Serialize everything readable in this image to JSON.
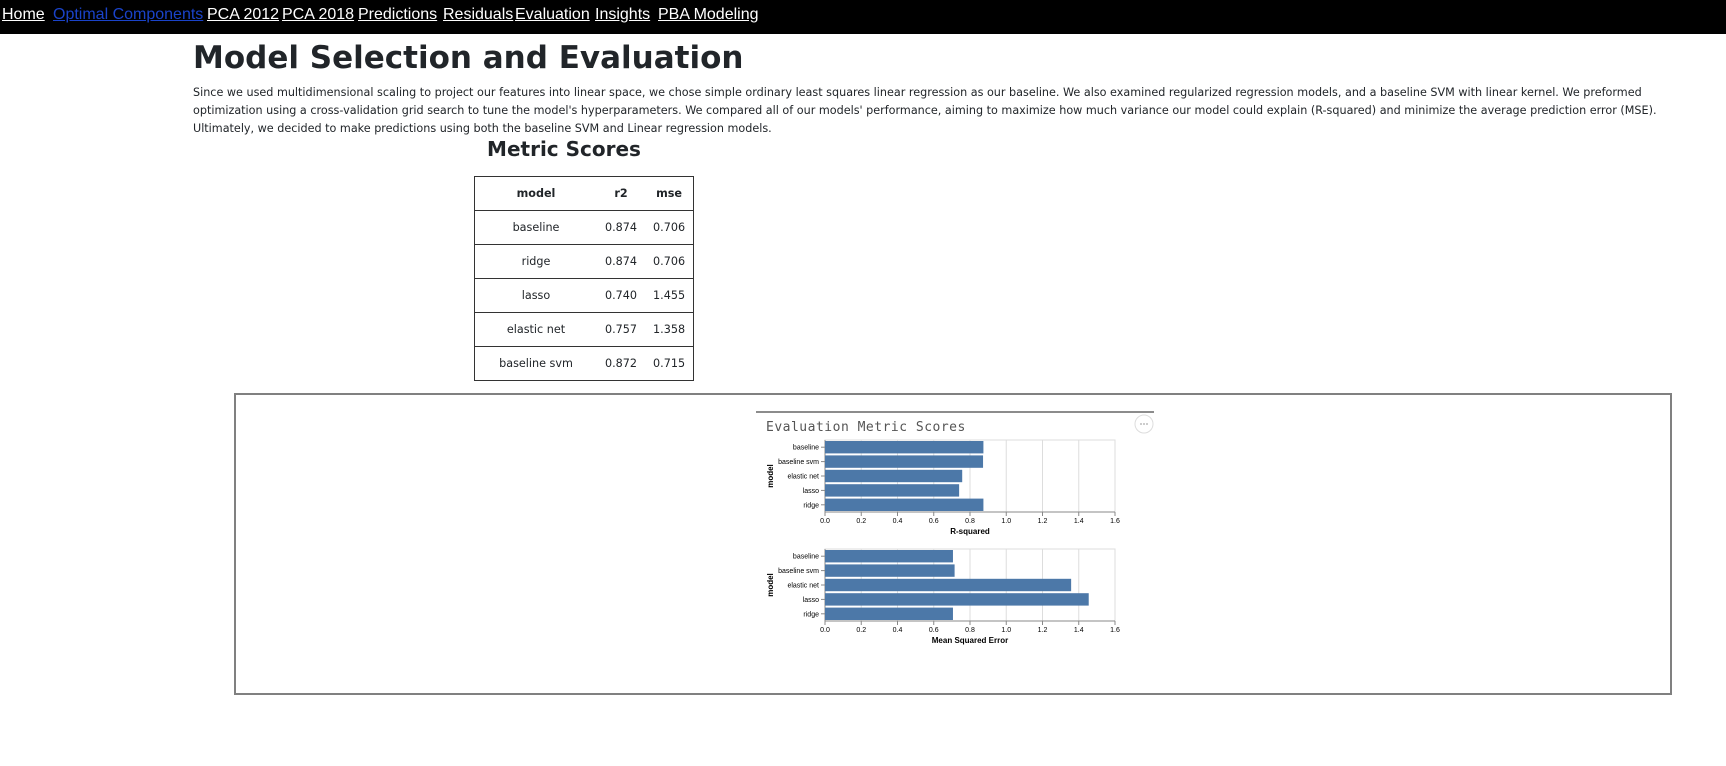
{
  "nav": {
    "items": [
      {
        "label": "Home",
        "active": false
      },
      {
        "label": "Optimal Components",
        "active": true
      },
      {
        "label": "PCA 2012",
        "active": false
      },
      {
        "label": "PCA 2018",
        "active": false
      },
      {
        "label": "Predictions",
        "active": false
      },
      {
        "label": "Residuals",
        "active": false
      },
      {
        "label": "Evaluation",
        "active": false
      },
      {
        "label": "Insights",
        "active": false
      },
      {
        "label": "PBA Modeling",
        "active": false
      }
    ]
  },
  "page": {
    "title": "Model Selection and Evaluation",
    "intro": "Since we used multidimensional scaling to project our features into linear space, we chose simple ordinary least squares linear regression as our baseline. We also examined regularized regression models, and a baseline SVM with linear kernel. We preformed optimization using a cross-validation grid search to tune the model's hyperparameters. We compared all of our models' performance, aiming to maximize how much variance our model could explain (R-squared) and minimize the average prediction error (MSE). Ultimately, we decided to make predictions using both the baseline SVM and Linear regression models."
  },
  "metrics": {
    "heading": "Metric Scores",
    "columns": [
      "model",
      "r2",
      "mse"
    ],
    "rows": [
      [
        "baseline",
        "0.874",
        "0.706"
      ],
      [
        "ridge",
        "0.874",
        "0.706"
      ],
      [
        "lasso",
        "0.740",
        "1.455"
      ],
      [
        "elastic net",
        "0.757",
        "1.358"
      ],
      [
        "baseline svm",
        "0.872",
        "0.715"
      ]
    ]
  },
  "chart_data": [
    {
      "type": "bar",
      "orientation": "horizontal",
      "title": "Evaluation Metric Scores",
      "ylabel": "model",
      "xlabel": "R-squared",
      "categories": [
        "baseline",
        "baseline svm",
        "elastic net",
        "lasso",
        "ridge"
      ],
      "values": [
        0.874,
        0.872,
        0.757,
        0.74,
        0.874
      ],
      "xlim": [
        0,
        1.6
      ],
      "xticks": [
        "0.0",
        "0.2",
        "0.4",
        "0.6",
        "0.8",
        "1.0",
        "1.2",
        "1.4",
        "1.6"
      ],
      "grid": true,
      "color": "#4c78a8"
    },
    {
      "type": "bar",
      "orientation": "horizontal",
      "ylabel": "model",
      "xlabel": "Mean Squared Error",
      "categories": [
        "baseline",
        "baseline svm",
        "elastic net",
        "lasso",
        "ridge"
      ],
      "values": [
        0.706,
        0.715,
        1.358,
        1.455,
        0.706
      ],
      "xlim": [
        0,
        1.6
      ],
      "xticks": [
        "0.0",
        "0.2",
        "0.4",
        "0.6",
        "0.8",
        "1.0",
        "1.2",
        "1.4",
        "1.6"
      ],
      "grid": true,
      "color": "#4c78a8"
    }
  ],
  "chart_menu": {
    "icon": "ellipsis-icon"
  }
}
